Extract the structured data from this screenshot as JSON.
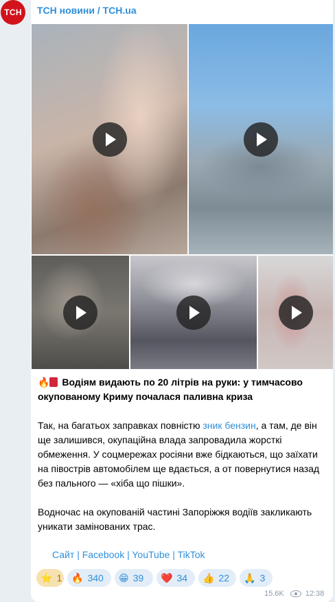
{
  "avatar": {
    "text": "ТСН"
  },
  "channel": {
    "name": "ТСН новини / TCH.ua"
  },
  "media": [
    {
      "type": "video"
    },
    {
      "type": "video"
    },
    {
      "type": "video"
    },
    {
      "type": "video"
    },
    {
      "type": "video"
    }
  ],
  "post": {
    "title_emoji": "🔥",
    "title": "Водіям видають по 20 літрів на руки: у тимчасово окупованому Криму почалася паливна криза",
    "p1_before": "Так, на багатьох заправках повністю ",
    "p1_link": "зник бензин",
    "p1_after": ", а там, де він ще залишився, окупаційна влада запровадила жорсткі обмеження. У соцмережах росіяни вже бідкаються, що заїхати на півострів автомобілем ще вдається, а от повернутися назад без пального — «хіба що пішки».",
    "p2": "Водночас на окупованій частині Запоріжжя водіїв закликають уникати замінованих трас."
  },
  "links": {
    "site": "Сайт",
    "facebook": "Facebook",
    "youtube": "YouTube",
    "tiktok": "TikTok",
    "separator": "|"
  },
  "reactions": [
    {
      "emoji": "⭐",
      "count": "1"
    },
    {
      "emoji": "🔥",
      "count": "340"
    },
    {
      "emoji": "😁",
      "count": "39"
    },
    {
      "emoji": "❤️",
      "count": "34"
    },
    {
      "emoji": "👍",
      "count": "22"
    },
    {
      "emoji": "🙏",
      "count": "3"
    }
  ],
  "footer": {
    "views": "15.6K",
    "time": "12:38"
  }
}
